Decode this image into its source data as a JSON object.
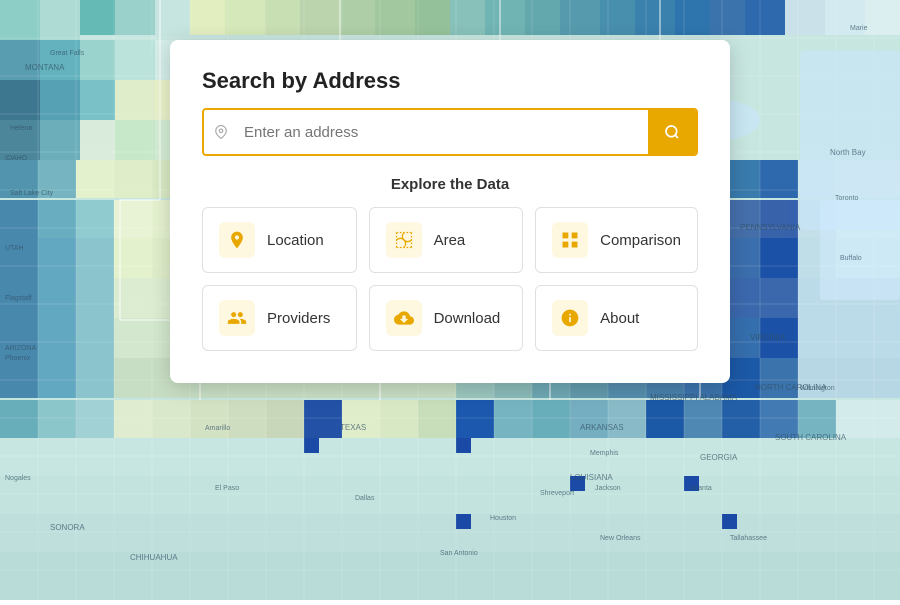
{
  "map": {
    "alt": "US choropleth map background"
  },
  "search": {
    "title": "Search by Address",
    "placeholder": "Enter an address",
    "button_label": "Search"
  },
  "explore": {
    "label": "Explore the Data",
    "items": [
      {
        "id": "location",
        "label": "Location",
        "icon": "📍",
        "icon_name": "location-pin-icon"
      },
      {
        "id": "area",
        "label": "Area",
        "icon": "🗺",
        "icon_name": "map-icon"
      },
      {
        "id": "comparison",
        "label": "Comparison",
        "icon": "⊞",
        "icon_name": "grid-icon"
      },
      {
        "id": "providers",
        "label": "Providers",
        "icon": "👥",
        "icon_name": "people-icon"
      },
      {
        "id": "download",
        "label": "Download",
        "icon": "☁",
        "icon_name": "download-cloud-icon"
      },
      {
        "id": "about",
        "label": "About",
        "icon": "ℹ",
        "icon_name": "info-icon"
      }
    ]
  }
}
